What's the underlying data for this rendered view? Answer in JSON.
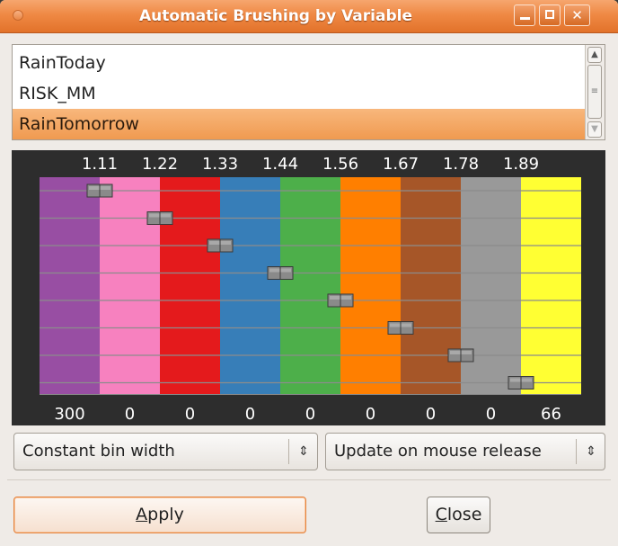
{
  "window": {
    "title": "Automatic Brushing by Variable",
    "buttons": [
      "minimize",
      "maximize",
      "close"
    ]
  },
  "variables": {
    "items": [
      "RainToday",
      "RISK_MM",
      "RainTomorrow"
    ],
    "selected": "RainTomorrow"
  },
  "brushing": {
    "bin_colors": [
      "#984ea3",
      "#f781bf",
      "#e41a1c",
      "#377eb8",
      "#4daf4a",
      "#ff7f00",
      "#a65628",
      "#999999",
      "#ffff33"
    ],
    "breakpoints": [
      "1.11",
      "1.22",
      "1.33",
      "1.44",
      "1.56",
      "1.67",
      "1.78",
      "1.89"
    ],
    "counts": [
      "300",
      "0",
      "0",
      "0",
      "0",
      "0",
      "0",
      "0",
      "66"
    ]
  },
  "options": {
    "binning_mode": "Constant bin width",
    "update_mode": "Update on mouse release"
  },
  "actions": {
    "apply_label": "Apply",
    "apply_mnemonic": "A",
    "apply_rest": "pply",
    "close_label": "Close",
    "close_mnemonic": "C",
    "close_rest": "lose"
  },
  "icons": {
    "minimize": "minimize-icon",
    "maximize": "maximize-icon",
    "close": "close-icon",
    "combo_arrow": "updown-arrow-icon"
  }
}
